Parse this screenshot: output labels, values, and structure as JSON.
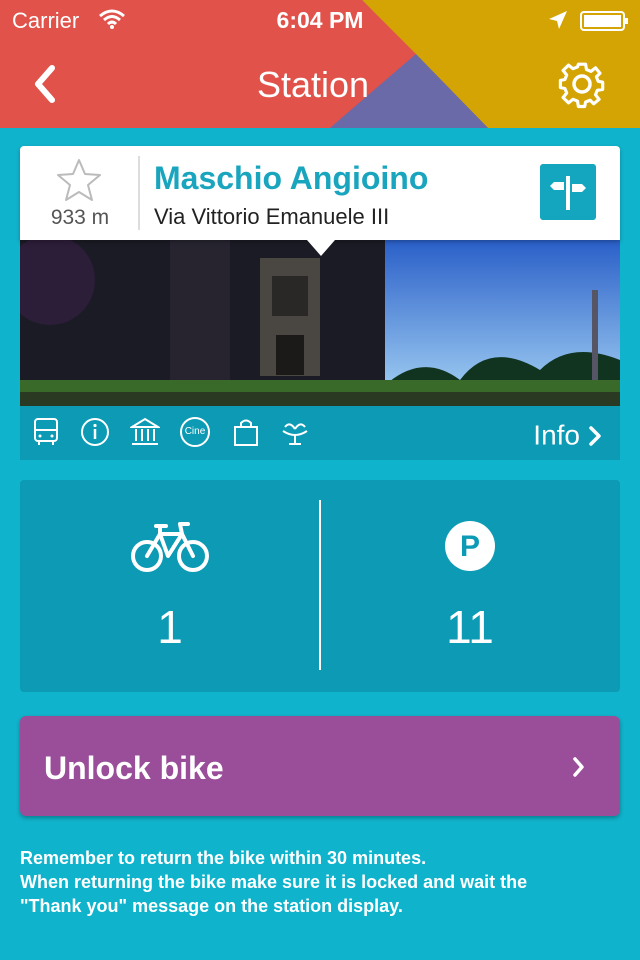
{
  "status_bar": {
    "carrier": "Carrier",
    "time": "6:04 PM",
    "wifi_icon": "wifi-icon",
    "location_icon": "location-arrow-icon",
    "battery_icon": "battery-full-icon"
  },
  "nav": {
    "title": "Station",
    "back_icon": "chevron-left-icon",
    "settings_icon": "gear-icon",
    "header_colors": [
      "#e0524a",
      "#c9473e",
      "#6a6aa8",
      "#d4a404"
    ]
  },
  "station": {
    "name": "Maschio Angioino",
    "address": "Via Vittorio Emanuele III",
    "distance": "933 m",
    "favorite_icon": "star-outline-icon",
    "directions_icon": "signpost-icon",
    "name_color": "#1aa5bf"
  },
  "amenities": {
    "icons": [
      "bus-icon",
      "info-icon",
      "museum-icon",
      "cine-icon",
      "shopping-bag-icon",
      "fountain-icon"
    ],
    "cine_text": "Cine",
    "info_label": "Info"
  },
  "availability": {
    "bikes": "1",
    "parking": "11",
    "bike_icon": "bicycle-icon",
    "parking_icon": "parking-icon",
    "parking_letter": "P"
  },
  "unlock": {
    "label": "Unlock bike",
    "color": "#9a4e9a"
  },
  "notice": {
    "line1": "Remember to return the bike within 30 minutes.",
    "line2": "When returning the bike make sure it is locked and wait the",
    "line3": "\"Thank you\" message on the station display."
  },
  "theme": {
    "background": "#10b3cc",
    "panel": "#0c9ab4"
  }
}
